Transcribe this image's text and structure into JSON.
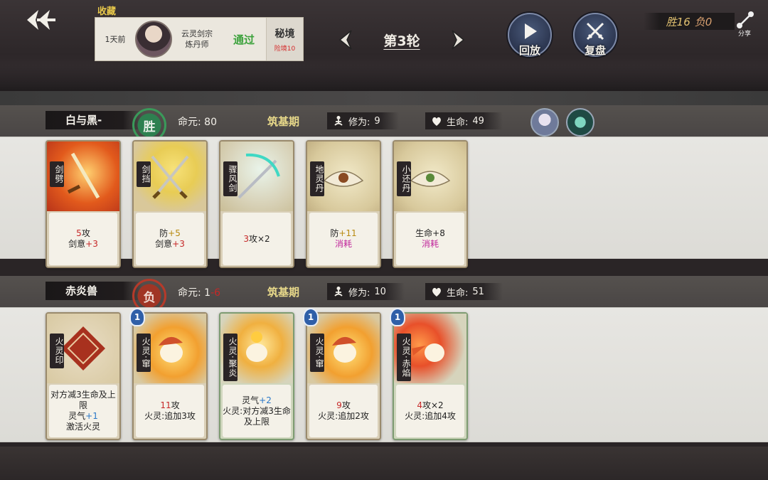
{
  "header": {
    "favorites_label": "收藏",
    "record": {
      "time": "1天前",
      "sect_line1": "云灵剑宗",
      "sect_line2": "炼丹师",
      "result": "通过",
      "mode": "秘境",
      "mode_sub": "险境10"
    },
    "round_label": "第3轮",
    "replay_label": "回放",
    "review_label": "复盘",
    "wins": "胜16",
    "losses": "负0",
    "share_label": "分享"
  },
  "player1": {
    "name": "白与黑-",
    "result": "胜",
    "life_label": "命元:",
    "life_value": "80",
    "realm": "筑基期",
    "cultivation_label": "修为:",
    "cultivation_value": "9",
    "hp_label": "生命:",
    "hp_value": "49",
    "cards": [
      {
        "name": "剑劈",
        "lines": [
          [
            {
              "t": "5",
              "c": "red"
            },
            {
              "t": "攻",
              "c": ""
            }
          ],
          [
            {
              "t": "剑意",
              "c": ""
            },
            {
              "t": "+3",
              "c": "red"
            }
          ]
        ]
      },
      {
        "name": "剑挡",
        "lines": [
          [
            {
              "t": "防",
              "c": ""
            },
            {
              "t": "+5",
              "c": "gold"
            }
          ],
          [
            {
              "t": "剑意",
              "c": ""
            },
            {
              "t": "+3",
              "c": "red"
            }
          ]
        ]
      },
      {
        "name": "骤风剑",
        "lines": [
          [
            {
              "t": "3",
              "c": "red"
            },
            {
              "t": "攻×2",
              "c": ""
            }
          ]
        ]
      },
      {
        "name": "地灵丹",
        "lines": [
          [
            {
              "t": "防",
              "c": ""
            },
            {
              "t": "+11",
              "c": "gold"
            }
          ],
          [
            {
              "t": "消耗",
              "c": "purple"
            }
          ]
        ]
      },
      {
        "name": "小还丹",
        "lines": [
          [
            {
              "t": "生命+8",
              "c": ""
            }
          ],
          [
            {
              "t": "消耗",
              "c": "purple"
            }
          ]
        ]
      }
    ]
  },
  "player2": {
    "name": "赤炎兽",
    "result": "负",
    "life_label": "命元:",
    "life_value_a": "1",
    "life_value_b": "-6",
    "realm": "筑基期",
    "cultivation_label": "修为:",
    "cultivation_value": "10",
    "hp_label": "生命:",
    "hp_value": "51",
    "cards": [
      {
        "name": "火灵印",
        "level": "",
        "lines": [
          [
            {
              "t": "对方减3生命及上限",
              "c": ""
            }
          ],
          [
            {
              "t": "灵气",
              "c": ""
            },
            {
              "t": "+1",
              "c": "blue"
            }
          ],
          [
            {
              "t": "激活火灵",
              "c": ""
            }
          ]
        ]
      },
      {
        "name": "火灵·窜",
        "level": "1",
        "lines": [
          [
            {
              "t": "11",
              "c": "red"
            },
            {
              "t": "攻",
              "c": ""
            }
          ],
          [
            {
              "t": "火灵:追加3攻",
              "c": ""
            }
          ]
        ]
      },
      {
        "name": "火灵·聚炎",
        "level": "",
        "lines": [
          [
            {
              "t": "灵气",
              "c": ""
            },
            {
              "t": "+2",
              "c": "blue"
            }
          ],
          [
            {
              "t": "火灵:对方减3生命及上限",
              "c": ""
            }
          ]
        ]
      },
      {
        "name": "火灵·窜",
        "level": "1",
        "lines": [
          [
            {
              "t": "9",
              "c": "red"
            },
            {
              "t": "攻",
              "c": ""
            }
          ],
          [
            {
              "t": "火灵:追加2攻",
              "c": ""
            }
          ]
        ]
      },
      {
        "name": "火灵·赤焰",
        "level": "1",
        "lines": [
          [
            {
              "t": "4",
              "c": "red"
            },
            {
              "t": "攻×2",
              "c": ""
            }
          ],
          [
            {
              "t": "火灵:追加4攻",
              "c": ""
            }
          ]
        ]
      }
    ]
  },
  "colors": {
    "win_green": "#3a9a5a",
    "loss_red": "#b53a2a",
    "realm_gold": "#e8d98a",
    "attack_red": "#c62828",
    "qi_blue": "#2a78c8",
    "consume_purple": "#c0249a"
  },
  "icons": [
    "back-arrow-icon",
    "left-arrow-icon",
    "right-arrow-icon",
    "play-icon",
    "crossed-swords-icon",
    "share-icon",
    "meditation-icon",
    "heart-drop-icon"
  ]
}
